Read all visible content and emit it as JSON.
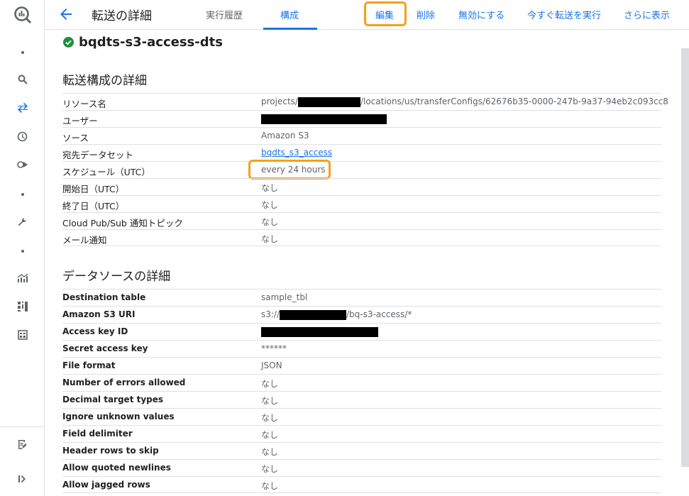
{
  "app": {
    "logo": "bigquery-logo"
  },
  "rail": {
    "items": [
      {
        "icon": "dot"
      },
      {
        "icon": "search-icon"
      },
      {
        "icon": "transfer-icon",
        "active": true
      },
      {
        "icon": "history-icon"
      },
      {
        "icon": "scheduled-query-icon"
      },
      {
        "icon": "dot"
      },
      {
        "icon": "wrench-icon"
      },
      {
        "icon": "dot"
      },
      {
        "icon": "analytics-icon"
      },
      {
        "icon": "dashboard-icon"
      },
      {
        "icon": "table-icon"
      },
      {
        "icon": "release-notes-icon"
      },
      {
        "icon": "expand-icon"
      }
    ]
  },
  "header": {
    "title": "転送の詳細",
    "tabs": [
      {
        "label": "実行履歴"
      },
      {
        "label": "構成",
        "selected": true
      }
    ],
    "actions": {
      "edit": "編集",
      "delete": "削除",
      "disable": "無効にする",
      "run_now": "今すぐ転送を実行",
      "more": "さらに表示"
    }
  },
  "config": {
    "name": "bqdts-s3-access-dts",
    "status": "success",
    "section1_title": "転送構成の詳細",
    "resource_name_label": "リソース名",
    "resource_prefix": "projects/",
    "resource_suffix": "/locations/us/transferConfigs/62676b35-0000-247b-9a37-94eb2c093cc8",
    "user_label": "ユーザー",
    "source_label": "ソース",
    "source_value": "Amazon S3",
    "dataset_label": "宛先データセット",
    "dataset_value": "bqdts_s3_access",
    "schedule_label": "スケジュール（UTC）",
    "schedule_value": "every 24 hours",
    "start_label": "開始日（UTC）",
    "start_value": "なし",
    "end_label": "終了日（UTC）",
    "end_value": "なし",
    "pubsub_label": "Cloud Pub/Sub 通知トピック",
    "pubsub_value": "なし",
    "email_label": "メール通知",
    "email_value": "なし"
  },
  "datasource": {
    "section_title": "データソースの詳細",
    "dest_table_label": "Destination table",
    "dest_table_value": "sample_tbl",
    "s3_uri_label": "Amazon S3 URI",
    "s3_uri_prefix": "s3://",
    "s3_uri_suffix": "/bq-s3-access/*",
    "access_key_label": "Access key ID",
    "secret_label": "Secret access key",
    "secret_value": "******",
    "file_format_label": "File format",
    "file_format_value": "JSON",
    "errors_label": "Number of errors allowed",
    "errors_value": "なし",
    "decimal_label": "Decimal target types",
    "decimal_value": "なし",
    "ignore_label": "Ignore unknown values",
    "ignore_value": "なし",
    "delimiter_label": "Field delimiter",
    "delimiter_value": "なし",
    "header_rows_label": "Header rows to skip",
    "header_rows_value": "なし",
    "quoted_label": "Allow quoted newlines",
    "quoted_value": "なし",
    "jagged_label": "Allow jagged rows",
    "jagged_value": "なし"
  },
  "colors": {
    "accent": "#1a73e8",
    "highlight": "#f5a01a",
    "success": "#1e8e3e"
  }
}
